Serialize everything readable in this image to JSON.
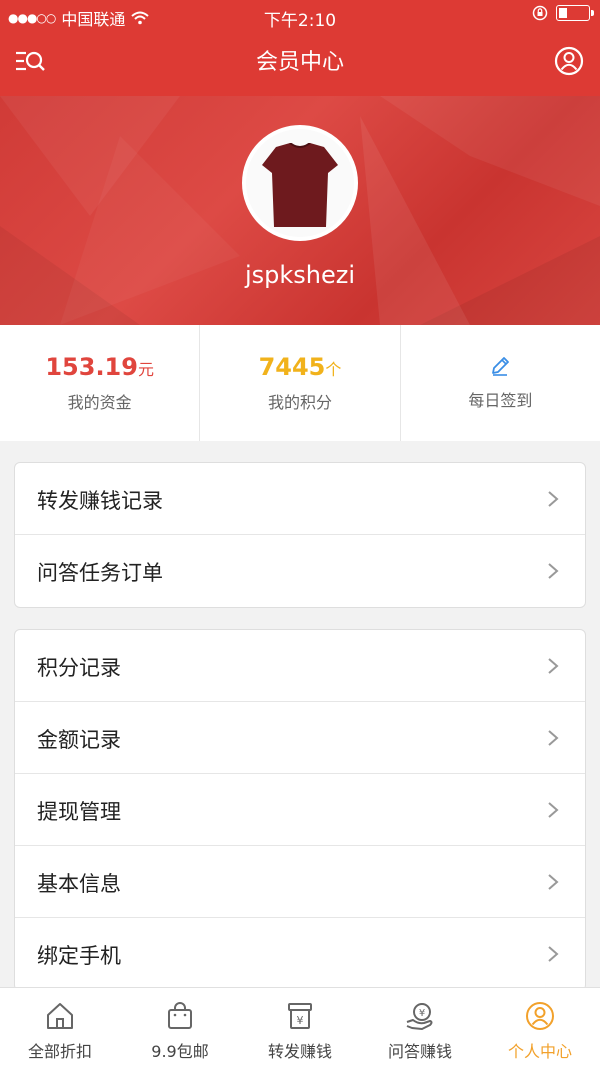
{
  "status_bar": {
    "carrier": "中国联通",
    "time": "下午2:10"
  },
  "nav": {
    "title": "会员中心",
    "menu_icon": "search-menu-icon",
    "user_icon": "user-circle-icon"
  },
  "profile": {
    "username": "jspkshezi"
  },
  "stats": {
    "funds": {
      "value": "153.19",
      "unit": "元",
      "label": "我的资金"
    },
    "points": {
      "value": "7445",
      "unit": "个",
      "label": "我的积分"
    },
    "checkin": {
      "label": "每日签到",
      "icon": "pencil-icon"
    }
  },
  "menu_group_1": [
    {
      "label": "转发赚钱记录"
    },
    {
      "label": "问答任务订单"
    }
  ],
  "menu_group_2": [
    {
      "label": "积分记录"
    },
    {
      "label": "金额记录"
    },
    {
      "label": "提现管理"
    },
    {
      "label": "基本信息"
    },
    {
      "label": "绑定手机"
    }
  ],
  "tabbar": [
    {
      "label": "全部折扣",
      "icon": "home-icon"
    },
    {
      "label": "9.9包邮",
      "icon": "shopping-bag-icon"
    },
    {
      "label": "转发赚钱",
      "icon": "yuan-box-icon"
    },
    {
      "label": "问答赚钱",
      "icon": "yuan-hand-icon"
    },
    {
      "label": "个人中心",
      "icon": "user-circle-icon",
      "active": true
    }
  ],
  "colors": {
    "brand_red": "#dd3a34",
    "funds_red": "#e0453d",
    "points_yellow": "#f1b21b",
    "active_tab": "#f2a12b"
  }
}
